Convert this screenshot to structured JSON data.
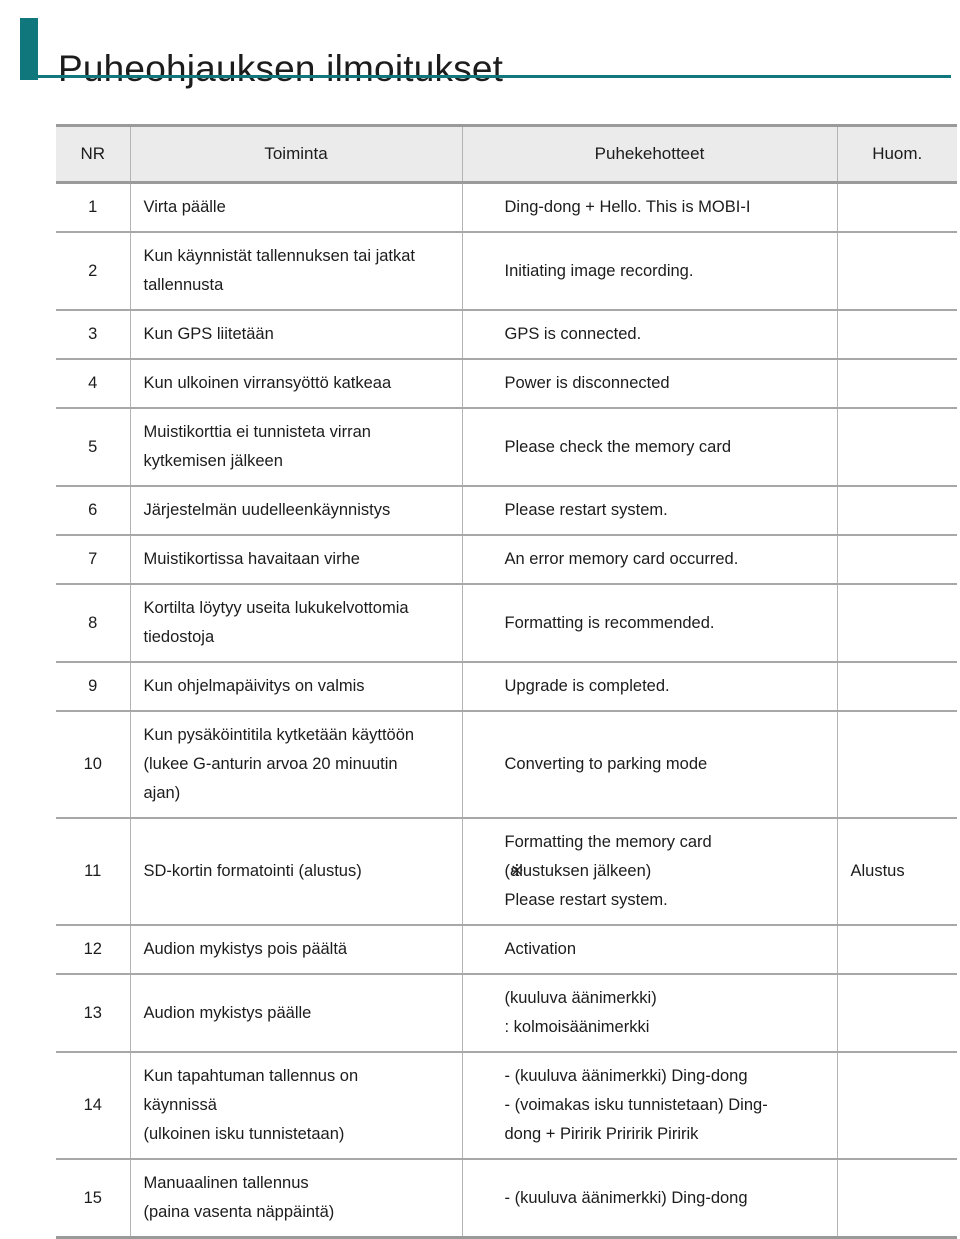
{
  "page": {
    "title": "Puheohjauksen ilmoitukset",
    "accent_color": "#10777d",
    "header_fill": "#ebebeb",
    "border_color": "#a8a8a8",
    "text_color": "#1c1c1c"
  },
  "table": {
    "columns": [
      {
        "key": "nr",
        "label": "NR"
      },
      {
        "key": "action",
        "label": "Toiminta"
      },
      {
        "key": "prompt",
        "label": "Puhekehotteet"
      },
      {
        "key": "note",
        "label": "Huom."
      }
    ],
    "rows": [
      {
        "nr": "1",
        "action": [
          "Virta päälle"
        ],
        "prompt": [
          "Ding-dong + Hello. This is MOBI-I"
        ],
        "note": ""
      },
      {
        "nr": "2",
        "action": [
          "Kun käynnistät tallennuksen tai jatkat",
          "tallennusta"
        ],
        "prompt": [
          "Initiating image recording."
        ],
        "note": ""
      },
      {
        "nr": "3",
        "action": [
          "Kun GPS liitetään"
        ],
        "prompt": [
          "GPS is connected."
        ],
        "note": ""
      },
      {
        "nr": "4",
        "action": [
          "Kun ulkoinen virransyöttö katkeaa"
        ],
        "prompt": [
          "Power is disconnected"
        ],
        "note": ""
      },
      {
        "nr": "5",
        "action": [
          "Muistikorttia ei tunnisteta virran",
          "kytkemisen jälkeen"
        ],
        "prompt": [
          "Please check the memory card"
        ],
        "note": ""
      },
      {
        "nr": "6",
        "action": [
          "Järjestelmän uudelleenkäynnistys"
        ],
        "prompt": [
          "Please restart system."
        ],
        "note": ""
      },
      {
        "nr": "7",
        "action": [
          "Muistikortissa havaitaan virhe"
        ],
        "prompt": [
          "An error memory card occurred."
        ],
        "note": ""
      },
      {
        "nr": "8",
        "action": [
          "Kortilta löytyy useita lukukelvottomia",
          "tiedostoja"
        ],
        "prompt": [
          "Formatting is recommended."
        ],
        "note": ""
      },
      {
        "nr": "9",
        "action": [
          "Kun ohjelmapäivitys on valmis"
        ],
        "prompt": [
          "Upgrade is completed."
        ],
        "note": ""
      },
      {
        "nr": "10",
        "action": [
          "Kun pysäköintitila kytketään käyttöön",
          "(lukee G-anturin arvoa 20 minuutin",
          "ajan)"
        ],
        "prompt": [
          "Converting to parking mode"
        ],
        "note": ""
      },
      {
        "nr": "11",
        "action": [
          "SD-kortin formatointi (alustus)"
        ],
        "prompt": [
          "Formatting the memory card",
          "( alustuksen jälkeen)",
          "Please restart system."
        ],
        "prompt_overstrike_line": 1,
        "prompt_overstrike_glyph": "※",
        "note": "Alustus"
      },
      {
        "nr": "12",
        "action": [
          "Audion mykistys pois päältä"
        ],
        "prompt": [
          "Activation"
        ],
        "note": ""
      },
      {
        "nr": "13",
        "action": [
          "Audion mykistys päälle"
        ],
        "prompt": [
          "(kuuluva äänimerkki)",
          ": kolmoisäänimerkki"
        ],
        "note": ""
      },
      {
        "nr": "14",
        "action": [
          "Kun tapahtuman tallennus on",
          "käynnissä",
          "(ulkoinen isku tunnistetaan)"
        ],
        "prompt": [
          "- (kuuluva äänimerkki) Ding-dong",
          "- (voimakas isku tunnistetaan) Ding-",
          "dong + Piririk Priririk Piririk"
        ],
        "note": ""
      },
      {
        "nr": "15",
        "action": [
          "Manuaalinen tallennus",
          "(paina vasenta näppäintä)"
        ],
        "prompt": [
          "- (kuuluva äänimerkki) Ding-dong"
        ],
        "note": ""
      }
    ]
  }
}
